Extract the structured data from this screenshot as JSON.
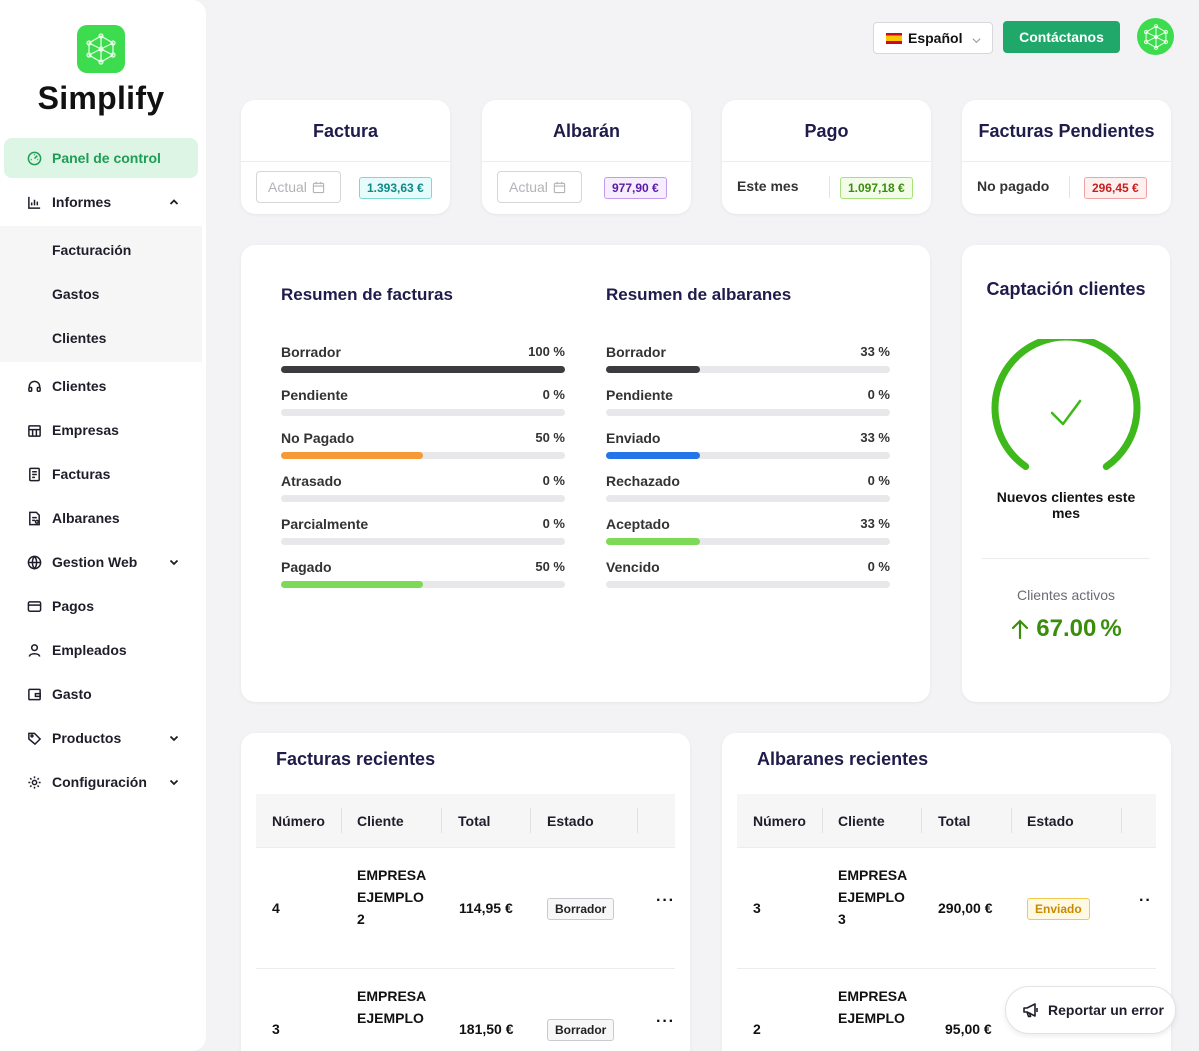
{
  "brand": {
    "name": "Simplify",
    "logo_icon": "network-logo-icon",
    "color": "#3ddc4f"
  },
  "sidebar": {
    "items": [
      {
        "label": "Panel de control",
        "icon": "dashboard-icon",
        "active": true
      },
      {
        "label": "Informes",
        "icon": "chart-icon",
        "expanded": true
      },
      {
        "label": "Clientes",
        "icon": "headset-icon"
      },
      {
        "label": "Empresas",
        "icon": "building-icon"
      },
      {
        "label": "Facturas",
        "icon": "invoice-icon"
      },
      {
        "label": "Albaranes",
        "icon": "delivery-note-icon"
      },
      {
        "label": "Gestion Web",
        "icon": "globe-icon",
        "expandable": true
      },
      {
        "label": "Pagos",
        "icon": "card-icon"
      },
      {
        "label": "Empleados",
        "icon": "user-icon"
      },
      {
        "label": "Gasto",
        "icon": "wallet-icon"
      },
      {
        "label": "Productos",
        "icon": "tag-icon",
        "expandable": true
      },
      {
        "label": "Configuración",
        "icon": "gear-icon",
        "expandable": true
      }
    ],
    "informes_sub": [
      "Facturación",
      "Gastos",
      "Clientes"
    ]
  },
  "topbar": {
    "language": "Español",
    "contact": "Contáctanos",
    "accent": "#1fa86a"
  },
  "summary_cards": [
    {
      "title": "Factura",
      "picker": "Actual",
      "amount": "1.393,63 €"
    },
    {
      "title": "Albarán",
      "picker": "Actual",
      "amount": "977,90 €"
    },
    {
      "title": "Pago",
      "label": "Este mes",
      "amount": "1.097,18 €"
    },
    {
      "title": "Facturas Pendientes",
      "label": "No pagado",
      "amount": "296,45 €"
    }
  ],
  "resumen_facturas": {
    "title": "Resumen de facturas",
    "rows": [
      {
        "label": "Borrador",
        "value": "100 %",
        "pct": 100,
        "color": "#3c3c40"
      },
      {
        "label": "Pendiente",
        "value": "0 %",
        "pct": 0,
        "color": "#3c3c40"
      },
      {
        "label": "No Pagado",
        "value": "50 %",
        "pct": 50,
        "color": "#f59a35"
      },
      {
        "label": "Atrasado",
        "value": "0 %",
        "pct": 0,
        "color": "#3c3c40"
      },
      {
        "label": "Parcialmente",
        "value": "0 %",
        "pct": 0,
        "color": "#3c3c40"
      },
      {
        "label": "Pagado",
        "value": "50 %",
        "pct": 50,
        "color": "#7ed957"
      }
    ]
  },
  "resumen_albaranes": {
    "title": "Resumen de albaranes",
    "rows": [
      {
        "label": "Borrador",
        "value": "33 %",
        "pct": 33,
        "color": "#3c3c40"
      },
      {
        "label": "Pendiente",
        "value": "0 %",
        "pct": 0,
        "color": "#3c3c40"
      },
      {
        "label": "Enviado",
        "value": "33 %",
        "pct": 33,
        "color": "#2475e8"
      },
      {
        "label": "Rechazado",
        "value": "0 %",
        "pct": 0,
        "color": "#3c3c40"
      },
      {
        "label": "Aceptado",
        "value": "33 %",
        "pct": 33,
        "color": "#7ed957"
      },
      {
        "label": "Vencido",
        "value": "0 %",
        "pct": 0,
        "color": "#3c3c40"
      }
    ]
  },
  "captacion": {
    "title": "Captación clientes",
    "caption": "Nuevos clientes este mes",
    "active_label": "Clientes activos",
    "active_value": "67.00",
    "active_unit": "%",
    "gauge_color": "#3fb81c"
  },
  "facturas_recientes": {
    "title": "Facturas recientes",
    "columns": [
      "Número",
      "Cliente",
      "Total",
      "Estado"
    ],
    "rows": [
      {
        "numero": "4",
        "cliente": "EMPRESA EJEMPLO 2",
        "total": "114,95 €",
        "estado": "Borrador"
      },
      {
        "numero": "3",
        "cliente": "EMPRESA EJEMPLO",
        "total": "181,50 €",
        "estado": "Borrador"
      }
    ]
  },
  "albaranes_recientes": {
    "title": "Albaranes recientes",
    "columns": [
      "Número",
      "Cliente",
      "Total",
      "Estado"
    ],
    "rows": [
      {
        "numero": "3",
        "cliente": "EMPRESA EJEMPLO 3",
        "total": "290,00 €",
        "estado": "Enviado"
      },
      {
        "numero": "2",
        "cliente": "EMPRESA EJEMPLO",
        "total": "95,00 €",
        "estado": ""
      }
    ]
  },
  "report_button": "Reportar un error"
}
